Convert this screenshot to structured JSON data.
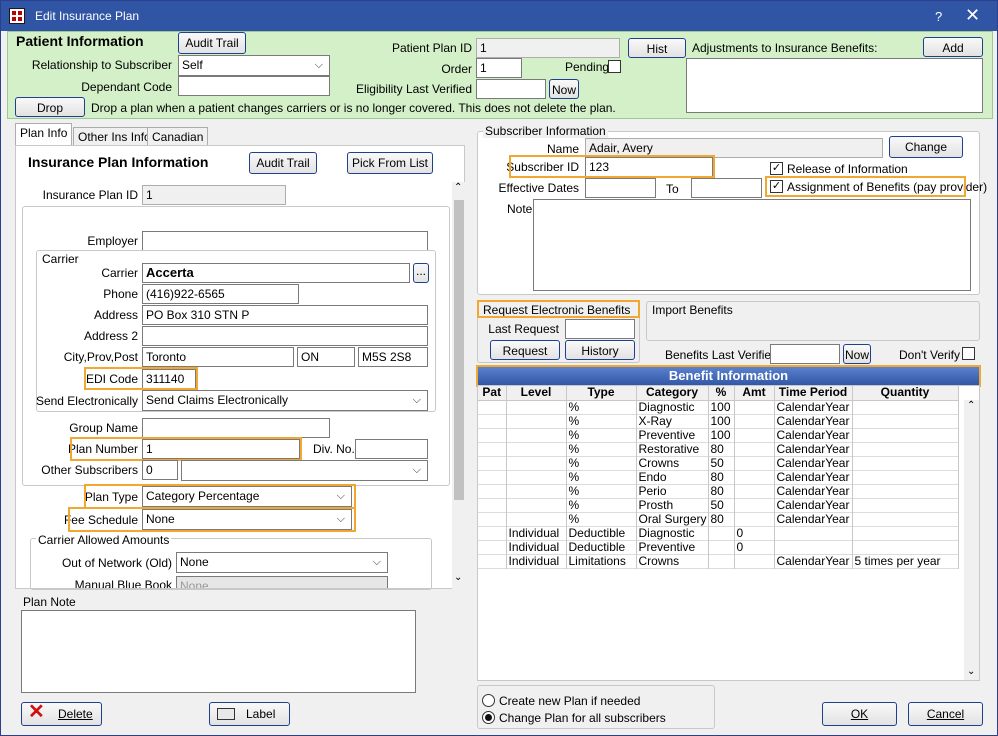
{
  "window": {
    "title": "Edit Insurance Plan",
    "help": "?",
    "close": "✕"
  },
  "patient": {
    "heading": "Patient Information",
    "audit_trail": "Audit Trail",
    "relationship_label": "Relationship to Subscriber",
    "relationship_value": "Self",
    "dependant_label": "Dependant Code",
    "dependant_value": "",
    "drop_button": "Drop",
    "drop_note": "Drop a plan when a patient changes carriers or is no longer covered.  This does not delete the plan.",
    "plan_id_label": "Patient Plan ID",
    "plan_id_value": "1",
    "order_label": "Order",
    "order_value": "1",
    "pending_label": "Pending",
    "elig_label": "Eligibility Last Verified",
    "elig_value": "",
    "now": "Now",
    "hist": "Hist",
    "adjustments_label": "Adjustments to Insurance Benefits:",
    "add": "Add"
  },
  "tabs": [
    "Plan Info",
    "Other Ins Info",
    "Canadian"
  ],
  "plan": {
    "heading": "Insurance Plan Information",
    "audit_trail": "Audit Trail",
    "pick_from_list": "Pick From List",
    "plan_id_label": "Insurance Plan ID",
    "plan_id_value": "1",
    "employer_label": "Employer",
    "employer_value": "",
    "carrier_group": "Carrier",
    "carrier_label": "Carrier",
    "carrier_value": "Accerta",
    "ellipsis": "...",
    "phone_label": "Phone",
    "phone_value": "(416)922-6565",
    "address_label": "Address",
    "address_value": "PO Box 310  STN P",
    "address2_label": "Address 2",
    "address2_value": "",
    "city_label": "City,Prov,Post",
    "city_value": "Toronto",
    "prov_value": "ON",
    "post_value": "M5S 2S8",
    "edi_label": "EDI Code",
    "edi_value": "311140",
    "send_label": "Send Electronically",
    "send_value": "Send Claims Electronically",
    "group_name_label": "Group Name",
    "group_name_value": "",
    "plan_number_label": "Plan Number",
    "plan_number_value": "1",
    "div_label": "Div. No.",
    "div_value": "",
    "other_subs_label": "Other Subscribers",
    "other_subs_value": "0",
    "plan_type_label": "Plan Type",
    "plan_type_value": "Category Percentage",
    "fee_label": "Fee Schedule",
    "fee_value": "None",
    "allowed_group": "Carrier Allowed Amounts",
    "out_network_label": "Out of Network (Old)",
    "out_network_value": "None",
    "manual_blue_label": "Manual Blue Book",
    "manual_blue_value": "None",
    "plan_note_label": "Plan Note",
    "plan_note_value": ""
  },
  "subscriber": {
    "group": "Subscriber Information",
    "name_label": "Name",
    "name_value": "Adair, Avery",
    "change": "Change",
    "id_label": "Subscriber ID",
    "id_value": "123",
    "release_label": "Release of Information",
    "assignment_label": "Assignment of Benefits (pay provider)",
    "eff_label": "Effective Dates",
    "eff_from": "",
    "to_label": "To",
    "eff_to": "",
    "note_label": "Note",
    "note_value": ""
  },
  "electronic": {
    "request_label": "Request Electronic Benefits",
    "last_request_label": "Last Request",
    "last_request_value": "",
    "request_button": "Request",
    "history_button": "History",
    "import_label": "Import Benefits",
    "verified_label": "Benefits Last Verified",
    "verified_value": "",
    "now": "Now",
    "dont_verify": "Don't Verify"
  },
  "benefits": {
    "title": "Benefit Information",
    "columns": [
      "Pat",
      "Level",
      "Type",
      "Category",
      "%",
      "Amt",
      "Time Period",
      "Quantity"
    ],
    "rows": [
      [
        "",
        "",
        "%",
        "Diagnostic",
        "100",
        "",
        "CalendarYear",
        ""
      ],
      [
        "",
        "",
        "%",
        "X-Ray",
        "100",
        "",
        "CalendarYear",
        ""
      ],
      [
        "",
        "",
        "%",
        "Preventive",
        "100",
        "",
        "CalendarYear",
        ""
      ],
      [
        "",
        "",
        "%",
        "Restorative",
        "80",
        "",
        "CalendarYear",
        ""
      ],
      [
        "",
        "",
        "%",
        "Crowns",
        "50",
        "",
        "CalendarYear",
        ""
      ],
      [
        "",
        "",
        "%",
        "Endo",
        "80",
        "",
        "CalendarYear",
        ""
      ],
      [
        "",
        "",
        "%",
        "Perio",
        "80",
        "",
        "CalendarYear",
        ""
      ],
      [
        "",
        "",
        "%",
        "Prosth",
        "50",
        "",
        "CalendarYear",
        ""
      ],
      [
        "",
        "",
        "%",
        "Oral Surgery",
        "80",
        "",
        "CalendarYear",
        ""
      ],
      [
        "",
        "Individual",
        "Deductible",
        "Diagnostic",
        "",
        "0",
        "",
        ""
      ],
      [
        "",
        "Individual",
        "Deductible",
        "Preventive",
        "",
        "0",
        "",
        ""
      ],
      [
        "",
        "Individual",
        "Limitations",
        "Crowns",
        "",
        "",
        "CalendarYear",
        "5 times per year"
      ]
    ]
  },
  "footer": {
    "delete": "Delete",
    "label": "Label",
    "radio_new": "Create new Plan if needed",
    "radio_change": "Change Plan for all subscribers",
    "ok": "OK",
    "cancel": "Cancel"
  },
  "colors": {
    "title_bar": "#2f55a4",
    "patient_bg": "#d4f0c8",
    "highlight": "#f0a830",
    "benefit_header": "#3c64b4"
  }
}
